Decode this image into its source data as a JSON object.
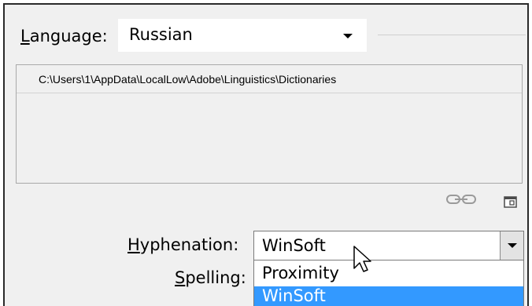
{
  "language": {
    "label_prefix": "L",
    "label_rest": "anguage:",
    "selected": "Russian"
  },
  "dictionaries": {
    "path": "C:\\Users\\1\\AppData\\LocalLow\\Adobe\\Linguistics\\Dictionaries"
  },
  "icons": {
    "link": "chain-link-icon",
    "new": "new-item-icon",
    "cursor": "mouse-pointer-icon"
  },
  "hyphenation": {
    "label_prefix": "H",
    "label_rest": "yphenation:",
    "selected": "WinSoft",
    "options": [
      "Proximity",
      "WinSoft"
    ]
  },
  "spelling": {
    "label_prefix": "S",
    "label_rest": "pelling:"
  },
  "colors": {
    "highlight": "#3399ff",
    "panel": "#f0f0f0"
  }
}
